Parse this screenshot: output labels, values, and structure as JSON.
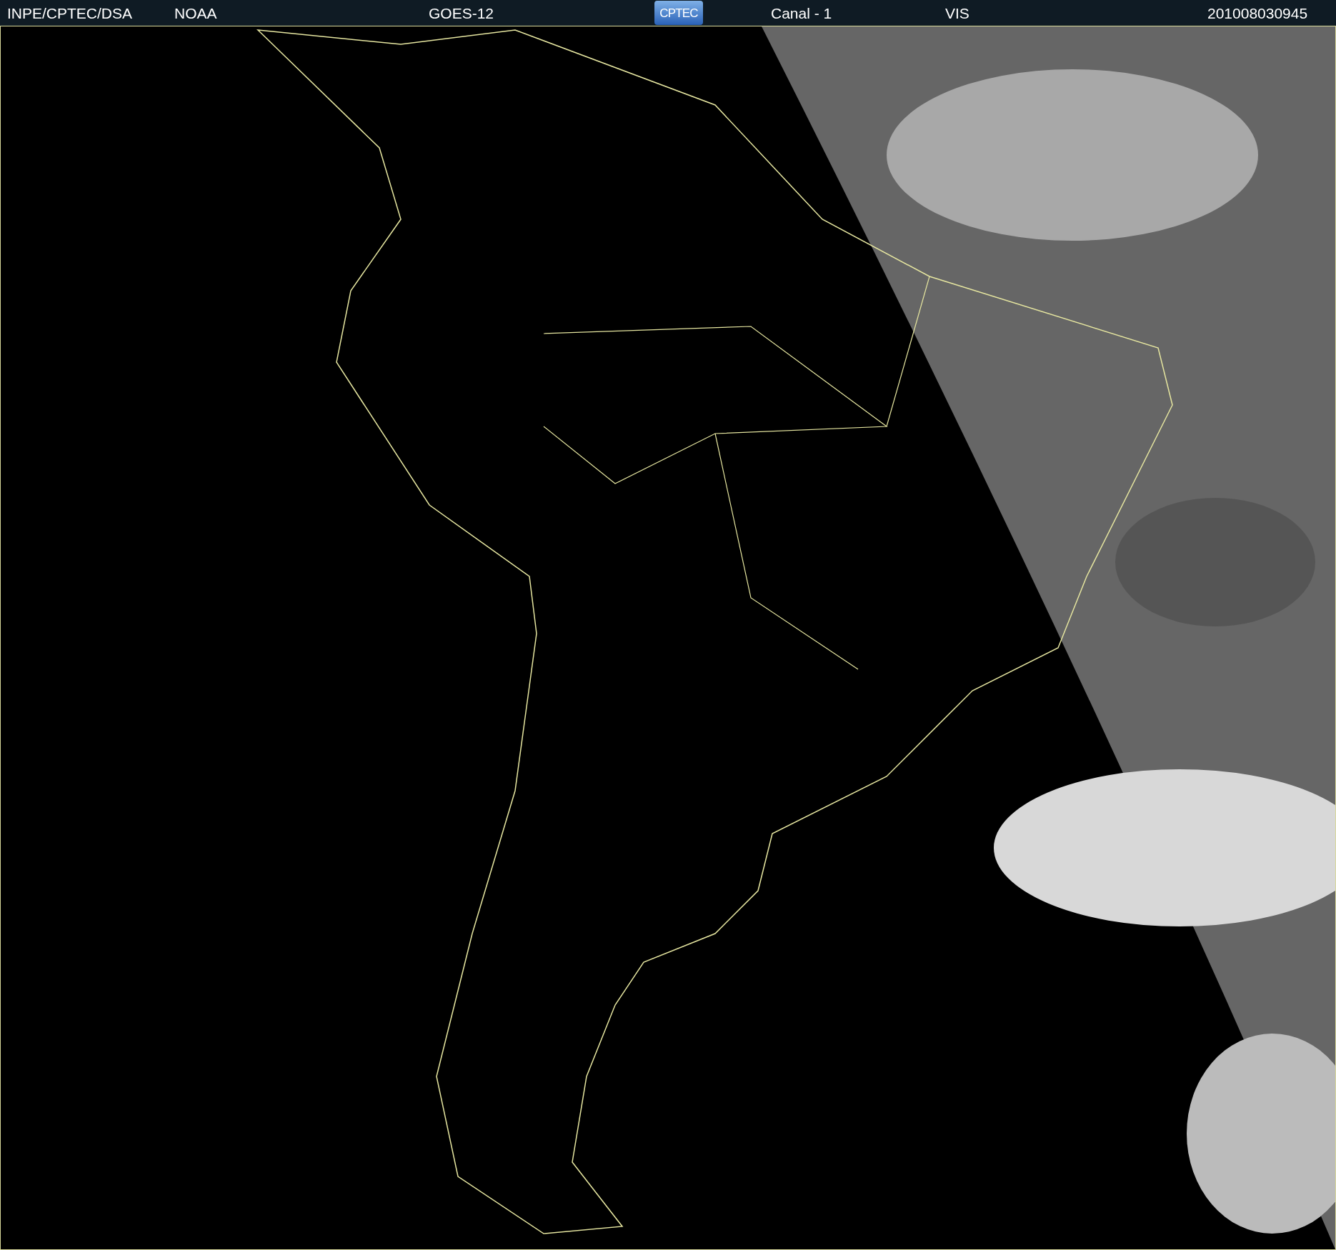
{
  "header": {
    "agency": "INPE/CPTEC/DSA",
    "source": "NOAA",
    "satellite": "GOES-12",
    "logo": "CPTEC",
    "channel": "Canal - 1",
    "band": "VIS",
    "timestamp": "201008030945"
  }
}
